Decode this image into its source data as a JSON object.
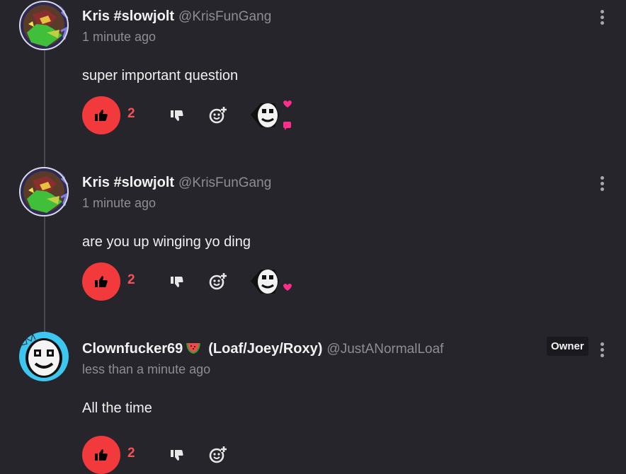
{
  "comments": [
    {
      "display_name": "Kris #slowjolt",
      "handle": "@KrisFunGang",
      "time": "1 minute ago",
      "text": "super important question",
      "likes": "2",
      "owner": false
    },
    {
      "display_name": "Kris #slowjolt",
      "handle": "@KrisFunGang",
      "time": "1 minute ago",
      "text": "are you up winging yo ding",
      "likes": "2",
      "owner": false
    },
    {
      "display_name": "Clownfucker69",
      "display_name_suffix": "(Loaf/Joey/Roxy)",
      "handle": "@JustANormalLoaf",
      "time": "less than a minute ago",
      "text": "All the time",
      "likes": "2",
      "badge": "Owner",
      "owner": true
    }
  ],
  "icons": {
    "like": "thumbs-up-icon",
    "dislike": "thumbs-down-icon",
    "react": "add-reaction-icon",
    "menu": "kebab-menu-icon",
    "emoji": "watermelon-icon"
  },
  "colors": {
    "background": "#26252b",
    "like_accent": "#f2393c",
    "muted_text": "#8e8d94",
    "heart": "#ff2e8a",
    "owner_avatar_ring": "#3cc6f0"
  }
}
